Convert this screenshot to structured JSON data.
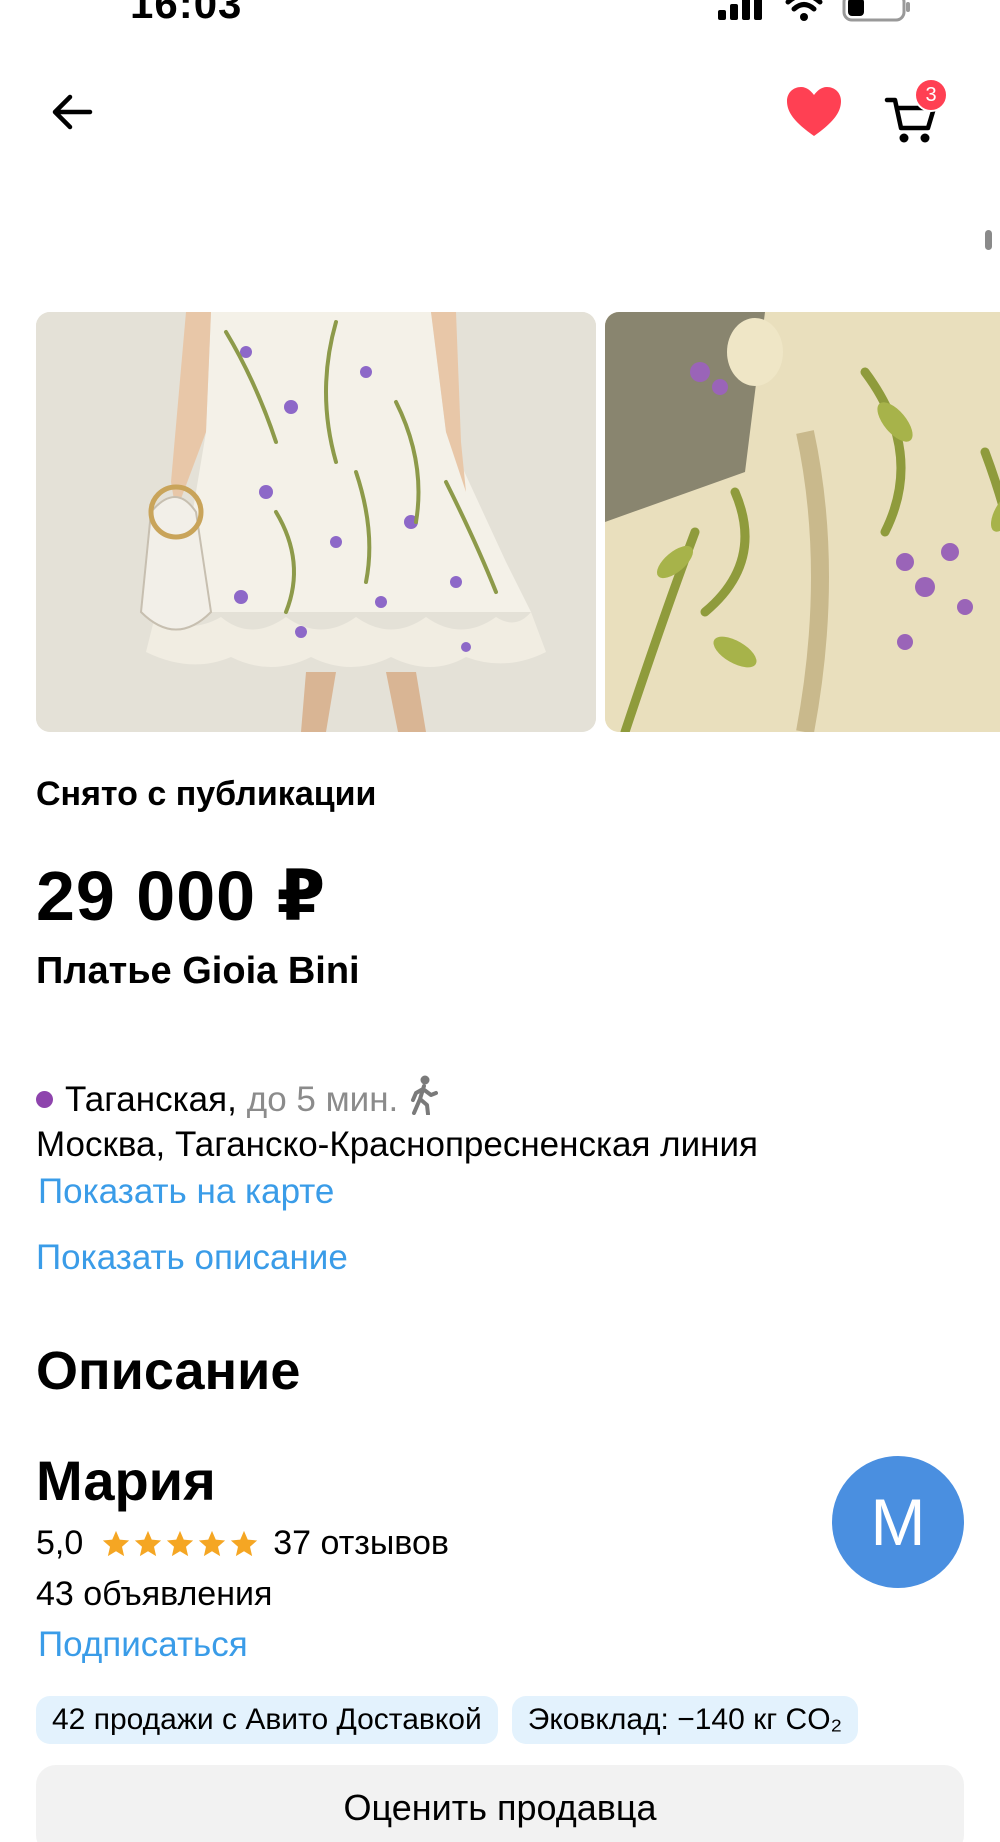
{
  "status_bar": {
    "time": "16:03"
  },
  "header": {
    "cart_count": "3"
  },
  "listing": {
    "status": "Снято с публикации",
    "price": "29 000 ₽",
    "title": "Платье Gioia Bini"
  },
  "location": {
    "metro_station": "Таганская,",
    "metro_time": "до 5 мин.",
    "metro_color": "#8e44ad",
    "address": "Москва, Таганско-Краснопресненская линия",
    "show_on_map": "Показать на карте",
    "show_description": "Показать описание"
  },
  "description": {
    "title": "Описание"
  },
  "seller": {
    "name": "Мария",
    "rating": "5,0",
    "stars": 5,
    "reviews": "37 отзывов",
    "ads": "43 объявления",
    "subscribe": "Подписаться",
    "avatar_letter": "M",
    "avatar_color": "#4a8fe0"
  },
  "chips": [
    "42 продажи с Авито Доставкой",
    "Эковклад: −140 кг CO₂"
  ],
  "actions": {
    "rate_seller": "Оценить продавца"
  },
  "colors": {
    "accent_link": "#3a9ce8",
    "badge": "#ff4053",
    "heart": "#ff4053",
    "star": "#f5a623"
  }
}
